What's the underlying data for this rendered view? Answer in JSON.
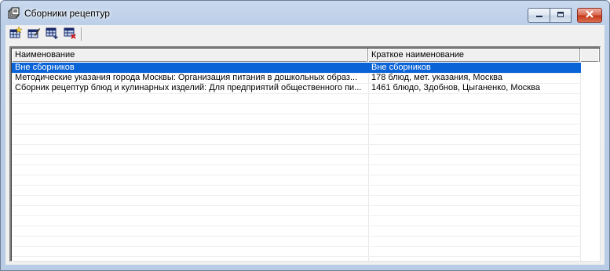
{
  "window": {
    "title": "Сборники рецептур",
    "icon": "books-icon"
  },
  "titlebar_buttons": [
    "minimize-icon",
    "maximize-icon",
    "close-icon"
  ],
  "toolbar": {
    "buttons": [
      "add-record-icon",
      "edit-record-icon",
      "add-row-icon",
      "delete-row-icon"
    ]
  },
  "list": {
    "columns": [
      "Наименование",
      "Краткое наименование"
    ],
    "rows": [
      {
        "name": "Вне сборников",
        "short": "Вне сборников",
        "selected": true
      },
      {
        "name": "Методические указания города Москвы: Организация питания в дошкольных образ...",
        "short": "178 блюд, мет. указания, Москва",
        "selected": false
      },
      {
        "name": "Сборник рецептур блюд и кулинарных изделий: Для предприятий общественного пи...",
        "short": "1461 блюдо, Здобнов, Цыганенко, Москва",
        "selected": false
      }
    ]
  },
  "colors": {
    "selection": "#0a64d7",
    "close_button": "#c5391b",
    "titlebar": "#c9d9ee"
  }
}
